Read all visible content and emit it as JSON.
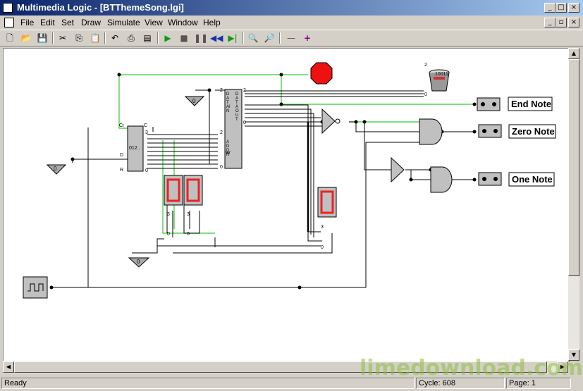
{
  "window": {
    "title": "Multimedia Logic - [BTThemeSong.lgi]"
  },
  "menu": [
    "File",
    "Edit",
    "Set",
    "Draw",
    "Simulate",
    "View",
    "Window",
    "Help"
  ],
  "toolbar": {
    "tools": [
      "new-icon",
      "open-icon",
      "save-icon",
      "cut-icon",
      "copy-icon",
      "paste-icon",
      "undo-icon",
      "print-icon",
      "print-preview-icon",
      "play-icon",
      "stop-icon",
      "pause-icon",
      "step-back-icon",
      "step-forward-icon",
      "zoom-out-icon",
      "zoom-in-icon",
      "line-tool-icon",
      "add-tool-icon"
    ]
  },
  "circuit": {
    "notes": [
      "End Note",
      "Zero Note",
      "One Note"
    ],
    "counter_label": "012..",
    "zero": "0",
    "one": "1",
    "two": "2",
    "three": "3",
    "pin_c": "C",
    "pin_ci": "Ci",
    "pin_d": "D",
    "pin_r": "R",
    "pin_w": "W",
    "ram_data_in": [
      "D",
      "A",
      "T",
      "A",
      "I",
      "N"
    ],
    "ram_data_out": [
      "D",
      "A",
      "T",
      "A",
      "O",
      "U",
      "T"
    ],
    "ram_addr": [
      "A",
      "D",
      "D",
      "R"
    ],
    "bucket_text": "10011"
  },
  "status": {
    "ready": "Ready",
    "cycle": "Cycle: 608",
    "page": "Page: 1"
  },
  "watermark": "limedownload.com",
  "colors": {
    "titlebar": "#0a246a",
    "wire_green": "#33cc33",
    "stop_red": "#ee1111",
    "led_red": "#ee2222"
  }
}
